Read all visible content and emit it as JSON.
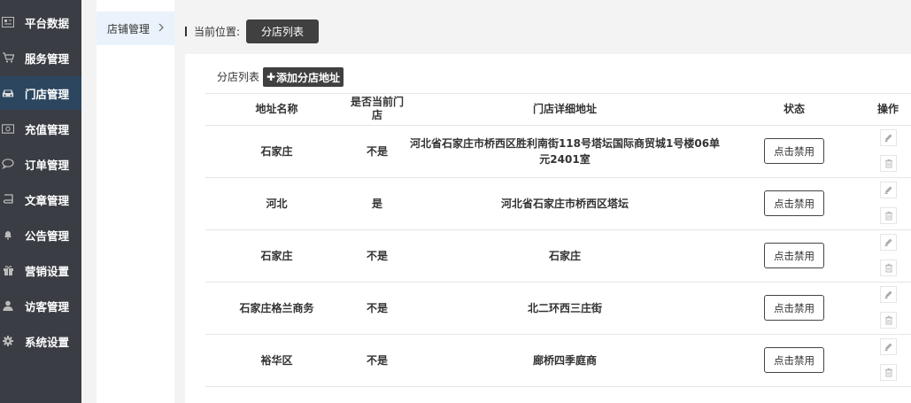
{
  "sidebar": {
    "items": [
      {
        "label": "平台数据",
        "icon": "dashboard-icon"
      },
      {
        "label": "服务管理",
        "icon": "cart-icon"
      },
      {
        "label": "门店管理",
        "icon": "car-icon"
      },
      {
        "label": "充值管理",
        "icon": "money-icon"
      },
      {
        "label": "订单管理",
        "icon": "chat-icon"
      },
      {
        "label": "文章管理",
        "icon": "book-icon"
      },
      {
        "label": "公告管理",
        "icon": "bell-icon"
      },
      {
        "label": "营销设置",
        "icon": "gift-icon"
      },
      {
        "label": "访客管理",
        "icon": "user-icon"
      },
      {
        "label": "系统设置",
        "icon": "gear-icon"
      }
    ],
    "active_index": 2
  },
  "subnav": {
    "label": "店铺管理"
  },
  "breadcrumb": {
    "label": "当前位置:",
    "current": "分店列表"
  },
  "panel": {
    "title": "分店列表",
    "add_label": "添加分店地址"
  },
  "table": {
    "headers": {
      "name": "地址名称",
      "current": "是否当前门店",
      "address": "门店详细地址",
      "status": "状态",
      "actions": "操作"
    },
    "rows": [
      {
        "name": "石家庄",
        "current": "不是",
        "address": "河北省石家庄市桥西区胜利南街118号塔坛国际商贸城1号楼06单元2401室",
        "status_button": "点击禁用"
      },
      {
        "name": "河北",
        "current": "是",
        "address": "河北省石家庄市桥西区塔坛",
        "status_button": "点击禁用"
      },
      {
        "name": "石家庄",
        "current": "不是",
        "address": "石家庄",
        "status_button": "点击禁用"
      },
      {
        "name": "石家庄格兰商务",
        "current": "不是",
        "address": "北二环西三庄街",
        "status_button": "点击禁用"
      },
      {
        "name": "裕华区",
        "current": "不是",
        "address": "廊桥四季庭商",
        "status_button": "点击禁用"
      }
    ]
  },
  "colors": {
    "sidebar_bg": "#3a3d43",
    "sidebar_active": "#2c4660",
    "dark_button": "#404040",
    "page_bg": "#f3f3f4"
  }
}
